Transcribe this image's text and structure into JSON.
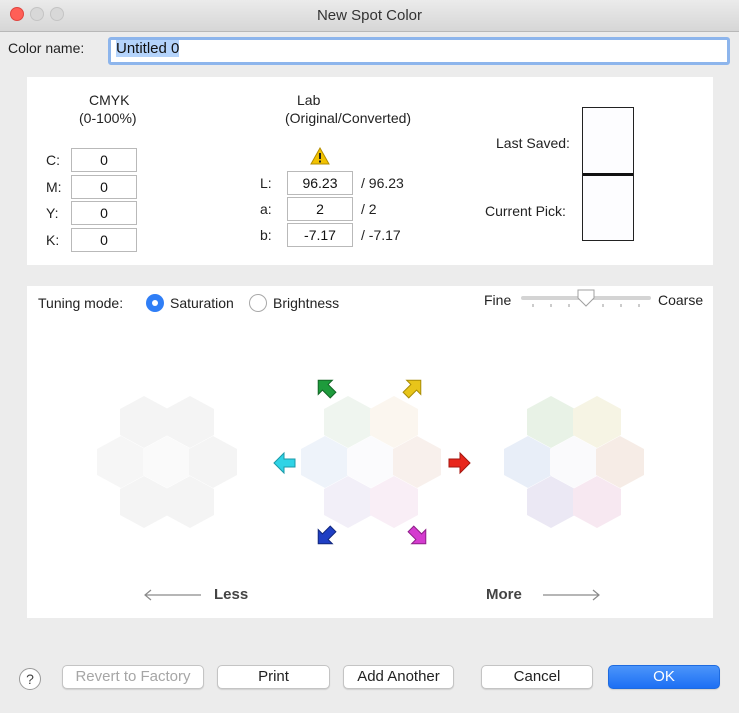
{
  "window": {
    "title": "New Spot Color"
  },
  "color_name": {
    "label": "Color name:",
    "value": "Untitled 0"
  },
  "cmyk": {
    "heading": "CMYK",
    "subheading": "(0-100%)",
    "rows": [
      {
        "label": "C:",
        "value": "0"
      },
      {
        "label": "M:",
        "value": "0"
      },
      {
        "label": "Y:",
        "value": "0"
      },
      {
        "label": "K:",
        "value": "0"
      }
    ]
  },
  "lab": {
    "heading": "Lab",
    "subheading": "(Original/Converted)",
    "rows": [
      {
        "label": "L:",
        "value": "96.23",
        "converted": "/ 96.23"
      },
      {
        "label": "a:",
        "value": "2",
        "converted": "/ 2"
      },
      {
        "label": "b:",
        "value": "-7.17",
        "converted": "/ -7.17"
      }
    ]
  },
  "swatch": {
    "last_saved_label": "Last Saved:",
    "current_pick_label": "Current Pick:"
  },
  "tuning": {
    "label": "Tuning mode:",
    "options": [
      {
        "label": "Saturation",
        "selected": true
      },
      {
        "label": "Brightness",
        "selected": false
      }
    ],
    "fine_label": "Fine",
    "coarse_label": "Coarse",
    "less_label": "Less",
    "more_label": "More"
  },
  "buttons": {
    "revert": "Revert to Factory",
    "print": "Print",
    "add_another": "Add Another",
    "cancel": "Cancel",
    "ok": "OK"
  },
  "colors": {
    "accent": "#2f7ef6",
    "warning": "#f2c200",
    "arrow_green": "#1e9b3c",
    "arrow_yellow": "#e8c51a",
    "arrow_cyan": "#2fd3e6",
    "arrow_red": "#e8261c",
    "arrow_blue": "#1f3fc4",
    "arrow_magenta": "#d43bcf"
  }
}
